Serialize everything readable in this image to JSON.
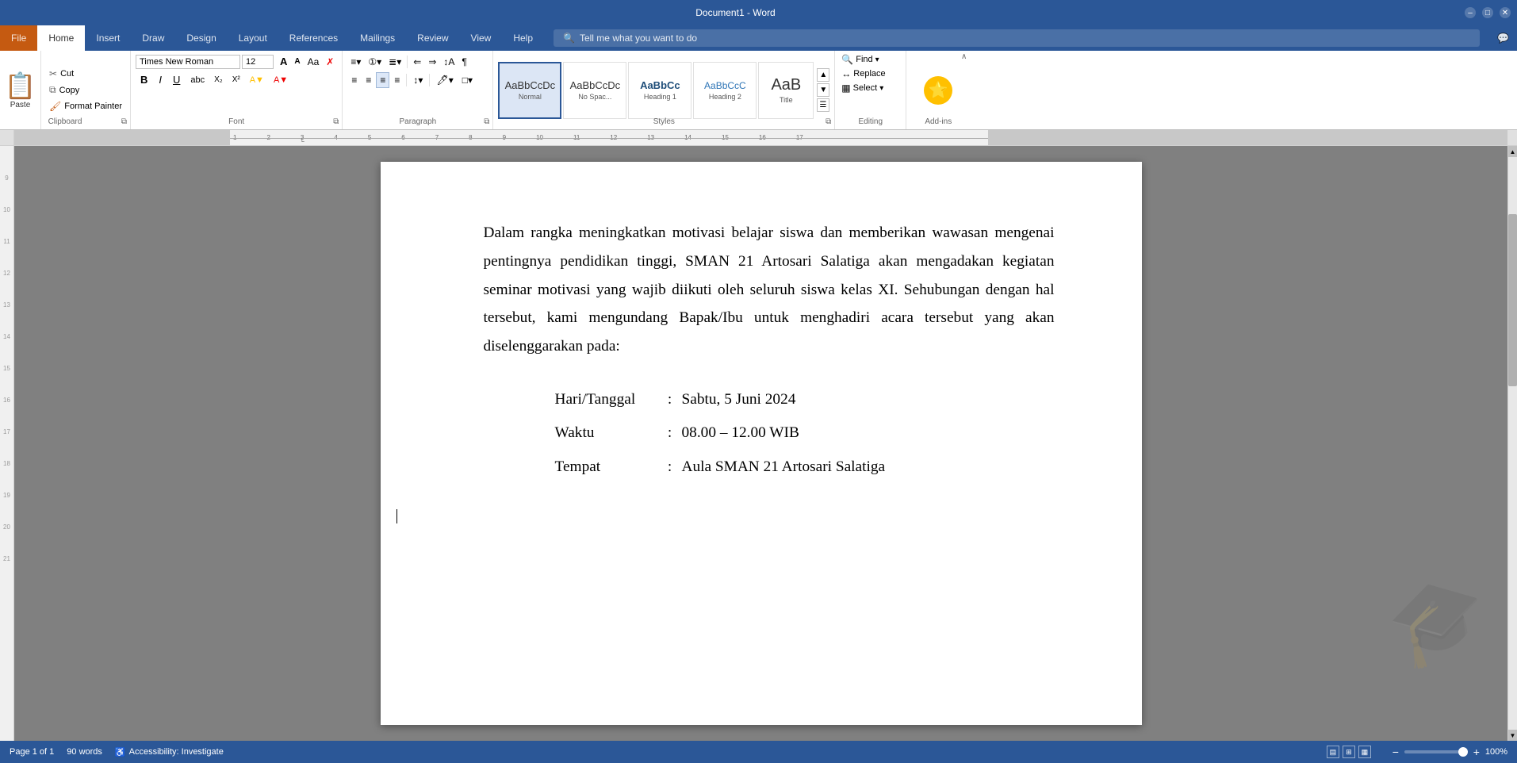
{
  "app": {
    "title": "Document1 - Word",
    "title_bar_color": "#2b5797"
  },
  "ribbon": {
    "tabs": [
      {
        "label": "File",
        "active": false
      },
      {
        "label": "Home",
        "active": true
      },
      {
        "label": "Insert",
        "active": false
      },
      {
        "label": "Draw",
        "active": false
      },
      {
        "label": "Design",
        "active": false
      },
      {
        "label": "Layout",
        "active": false
      },
      {
        "label": "References",
        "active": false
      },
      {
        "label": "Mailings",
        "active": false
      },
      {
        "label": "Review",
        "active": false
      },
      {
        "label": "View",
        "active": false
      },
      {
        "label": "Help",
        "active": false
      }
    ],
    "search_placeholder": "Tell me what you want to do",
    "groups": {
      "clipboard": {
        "label": "Clipboard",
        "paste_label": "Paste",
        "cut_label": "Cut",
        "copy_label": "Copy",
        "format_painter_label": "Format Painter"
      },
      "font": {
        "label": "Font",
        "font_name": "Times New Roman",
        "font_size": "12",
        "bold": "B",
        "italic": "I",
        "underline": "U"
      },
      "paragraph": {
        "label": "Paragraph"
      },
      "styles": {
        "label": "Styles",
        "items": [
          {
            "label": "Normal",
            "text": "AaBbCcDc",
            "active": true
          },
          {
            "label": "No Spac...",
            "text": "AaBbCcDc"
          },
          {
            "label": "Heading 1",
            "text": "AaBbCc"
          },
          {
            "label": "Heading 2",
            "text": "AaBbCcC"
          },
          {
            "label": "Title",
            "text": "AaB"
          }
        ]
      },
      "editing": {
        "label": "Editing",
        "find": "Find",
        "replace": "Replace",
        "select": "Select"
      },
      "addins": {
        "label": "Add-ins"
      }
    }
  },
  "document": {
    "paragraph1": "Dalam rangka meningkatkan motivasi belajar siswa dan memberikan wawasan mengenai pentingnya pendidikan tinggi, SMAN 21 Artosari Salatiga akan mengadakan kegiatan seminar motivasi yang wajib diikuti oleh seluruh siswa kelas XI. Sehubungan dengan hal tersebut, kami mengundang Bapak/Ibu untuk menghadiri acara tersebut yang akan diselenggarakan pada:",
    "details": [
      {
        "label": "Hari/Tanggal",
        "colon": ":",
        "value": "Sabtu, 5 Juni 2024"
      },
      {
        "label": "Waktu",
        "colon": ":",
        "value": "08.00 – 12.00 WIB"
      },
      {
        "label": "Tempat",
        "colon": ":",
        "value": "Aula SMAN 21 Artosari Salatiga"
      }
    ]
  },
  "status_bar": {
    "page_info": "Page 1 of 1",
    "word_count": "90 words",
    "accessibility": "Accessibility: Investigate",
    "zoom": "100%"
  }
}
